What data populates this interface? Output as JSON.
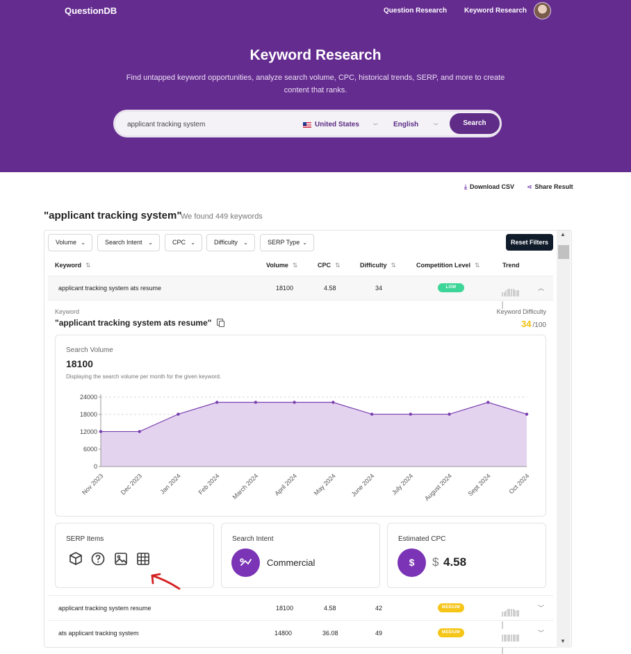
{
  "header": {
    "logo": "QuestionDB",
    "nav": [
      "Question Research",
      "Keyword Research"
    ]
  },
  "hero": {
    "title": "Keyword Research",
    "subtitle": "Find untapped keyword opportunities, analyze search volume, CPC, historical trends, SERP, and more to create content that ranks."
  },
  "search": {
    "query": "applicant tracking system",
    "country": "United States",
    "language": "English",
    "button": "Search"
  },
  "actions": {
    "download": "Download CSV",
    "share": "Share Result"
  },
  "results": {
    "query_title": "\"applicant tracking system\"",
    "count_text": "We found 449 keywords"
  },
  "filters": [
    "Volume",
    "Search Intent",
    "CPC",
    "Difficulty",
    "SERP Type"
  ],
  "reset_label": "Reset Filters",
  "table": {
    "columns": [
      "Keyword",
      "Volume",
      "CPC",
      "Difficulty",
      "Competition Level",
      "Trend"
    ],
    "rows": [
      {
        "keyword": "applicant tracking system ats resume",
        "volume": "18100",
        "cpc": "4.58",
        "difficulty": "34",
        "competition": "LOW"
      },
      {
        "keyword": "applicant tracking system resume",
        "volume": "18100",
        "cpc": "4.58",
        "difficulty": "42",
        "competition": "MEDIUM"
      },
      {
        "keyword": "ats applicant tracking system",
        "volume": "14800",
        "cpc": "36.08",
        "difficulty": "49",
        "competition": "MEDIUM"
      }
    ]
  },
  "detail": {
    "keyword_label": "Keyword",
    "keyword": "\"applicant tracking system ats resume\"",
    "kd_label": "Keyword Difficulty",
    "kd_value": "34",
    "kd_max": "/100",
    "search_volume_label": "Search Volume",
    "search_volume": "18100",
    "search_volume_desc": "Displaying the search volume per month for the given keyword.",
    "serp_title": "SERP Items",
    "serp_icons": [
      "cube-icon",
      "question-icon",
      "image-icon",
      "table-grid-icon"
    ],
    "intent_title": "Search Intent",
    "intent_value": "Commercial",
    "cpc_title": "Estimated CPC",
    "cpc_currency": "$",
    "cpc_value": "4.58"
  },
  "colors": {
    "brand": "#652c90",
    "accent": "#7a34b5",
    "low_badge": "#3ed598",
    "medium_badge": "#f5c518",
    "kd": "#f0c10f",
    "annotation_arrow": "#d32020"
  },
  "chart_data": {
    "type": "area",
    "title": "Search Volume",
    "categories": [
      "Nov 2023",
      "Dec 2023",
      "Jan 2024",
      "Feb 2024",
      "March 2024",
      "April 2024",
      "May 2024",
      "June 2024",
      "July 2024",
      "August 2024",
      "Sept 2024",
      "Oct 2024"
    ],
    "values": [
      12100,
      12100,
      18100,
      22200,
      22200,
      22200,
      22200,
      18100,
      18100,
      18100,
      22200,
      18100
    ],
    "yticks": [
      0,
      6000,
      12000,
      18000,
      24000
    ],
    "ylim": [
      0,
      24000
    ],
    "grid": true
  }
}
